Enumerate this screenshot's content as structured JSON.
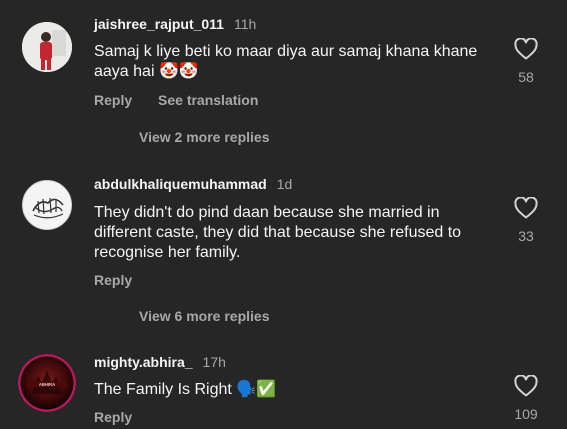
{
  "comments": [
    {
      "username": "jaishree_rajput_011",
      "time": "11h",
      "text": "Samaj k liye beti ko maar diya aur samaj khana khane aaya hai 🤡🤡",
      "reply_label": "Reply",
      "translate_label": "See translation",
      "likes": "58",
      "view_more": "View 2 more replies"
    },
    {
      "username": "abdulkhaliquemuhammad",
      "time": "1d",
      "text": "They didn't do pind daan because she married in different caste, they did that because she refused to recognise her family.",
      "reply_label": "Reply",
      "likes": "33",
      "view_more": "View 6 more replies"
    },
    {
      "username": "mighty.abhira_",
      "time": "17h",
      "text": "The Family Is Right 🗣️✅",
      "reply_label": "Reply",
      "likes": "109"
    }
  ],
  "colors": {
    "background": "#262626",
    "text_primary": "#f5f5f5",
    "text_secondary": "#a8a8a8"
  },
  "icons": [
    "heart-outline-icon"
  ]
}
